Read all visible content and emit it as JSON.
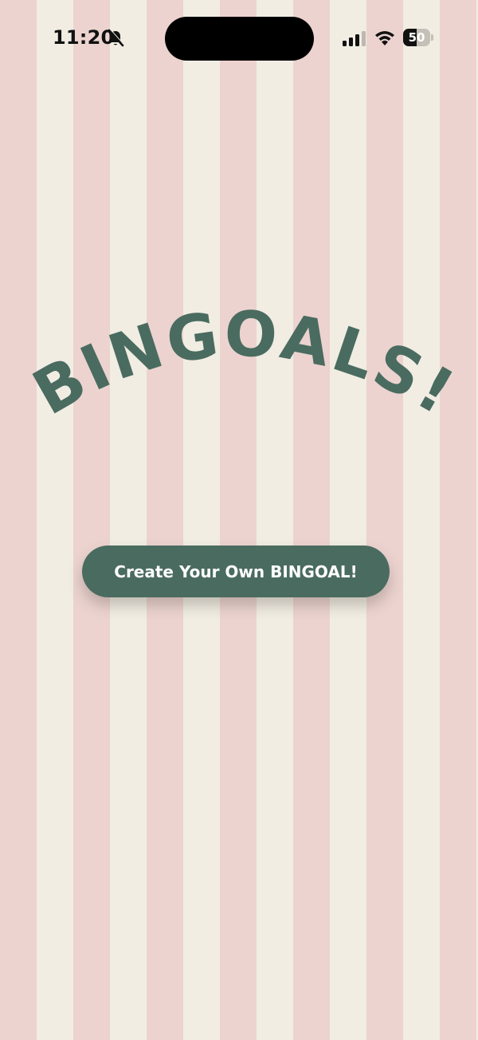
{
  "status_bar": {
    "time": "11:20",
    "battery_level": "50",
    "battery_fraction": 0.5,
    "icons": [
      "bell-slash-icon",
      "cellular-signal-icon",
      "wifi-icon",
      "battery-icon"
    ]
  },
  "app": {
    "title": "BINGOALS!",
    "cta_label": "Create Your Own BINGOAL!"
  },
  "colors": {
    "accent": "#4a6b60",
    "stripe_pink": "#ecd3cf",
    "stripe_cream": "#f1ede3",
    "button_text": "#ffffff"
  }
}
